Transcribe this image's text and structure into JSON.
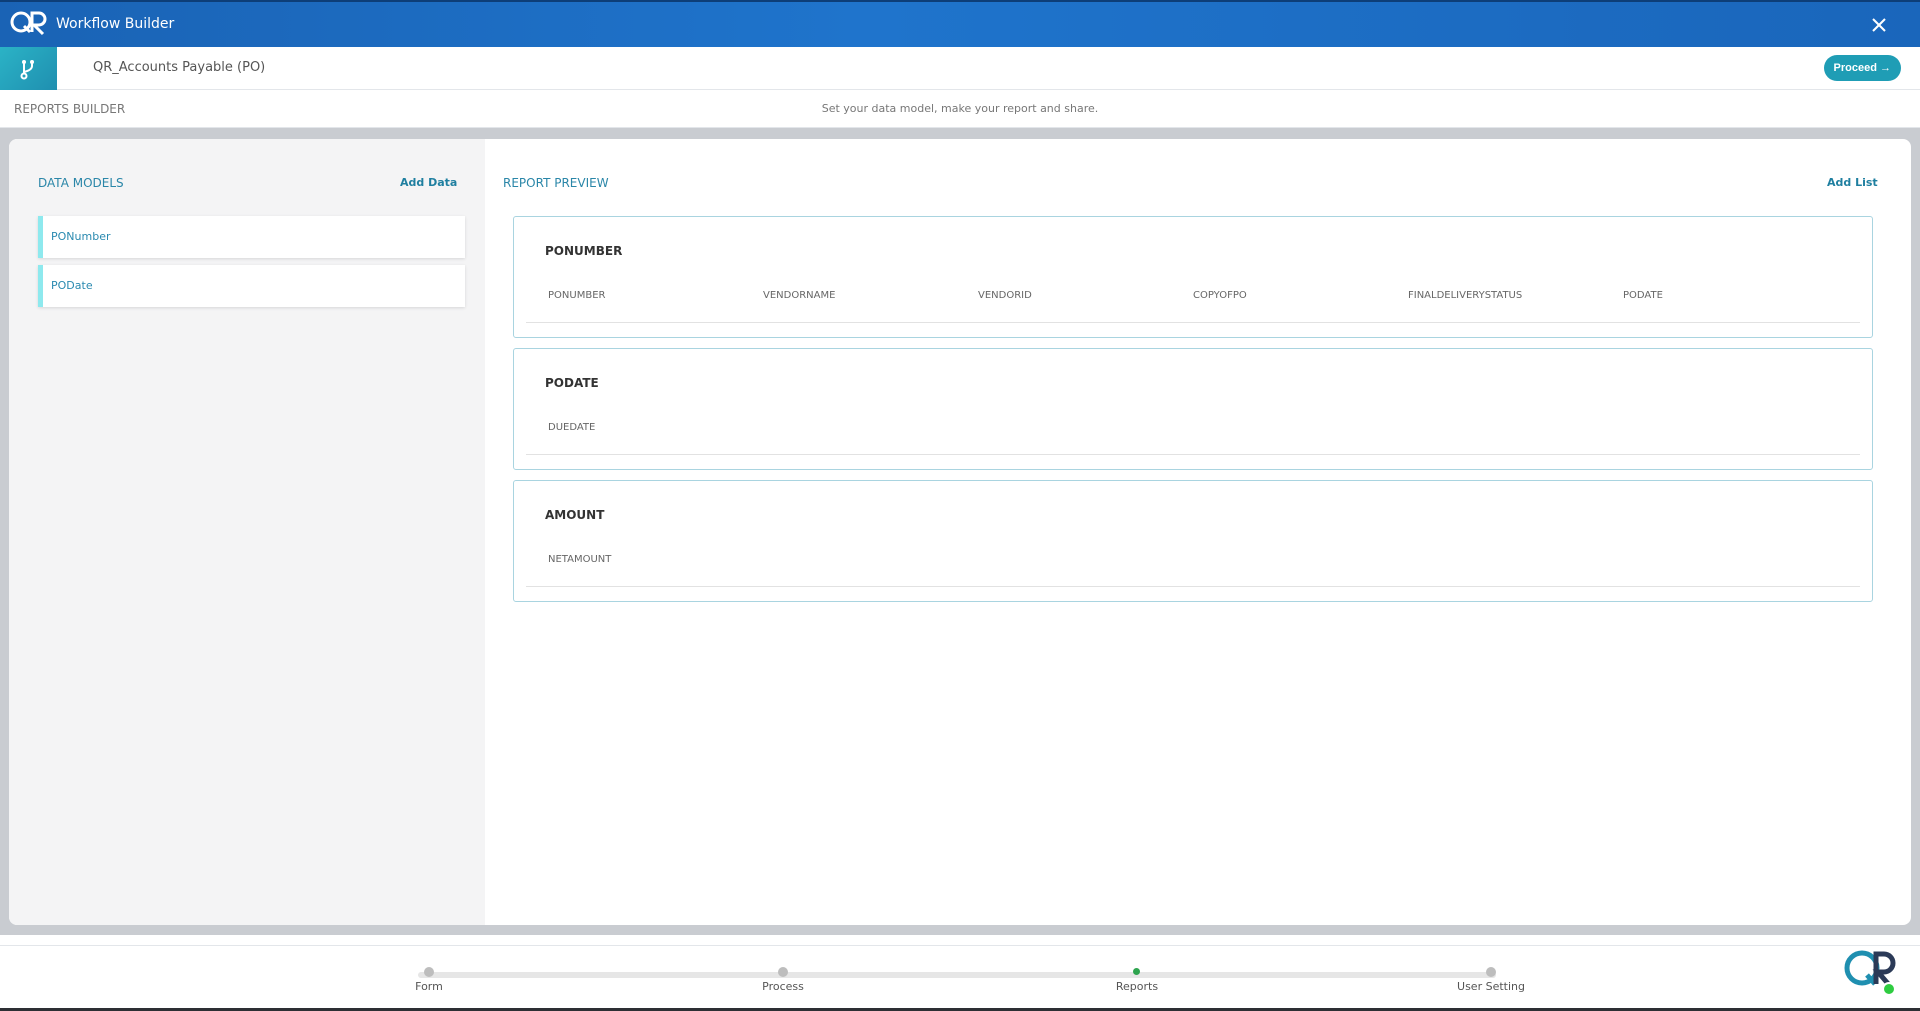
{
  "app": {
    "title": "Workflow Builder"
  },
  "workflow": {
    "name": "QR_Accounts Payable (PO)",
    "proceed_label": "Proceed →"
  },
  "builder": {
    "title": "REPORTS BUILDER",
    "subtitle": "Set your data model, make your report and share."
  },
  "data_models": {
    "title": "DATA MODELS",
    "add_label": "Add Data",
    "items": [
      "PONumber",
      "PODate"
    ]
  },
  "report_preview": {
    "title": "REPORT PREVIEW",
    "add_label": "Add List",
    "lists": [
      {
        "title": "PONUMBER",
        "columns": [
          "PONUMBER",
          "VENDORNAME",
          "VENDORID",
          "COPYOFPO",
          "FINALDELIVERYSTATUS",
          "PODATE"
        ]
      },
      {
        "title": "PODATE",
        "columns": [
          "DUEDATE"
        ]
      },
      {
        "title": "AMOUNT",
        "columns": [
          "NETAMOUNT"
        ]
      }
    ]
  },
  "stepper": {
    "steps": [
      "Form",
      "Process",
      "Reports",
      "User Setting"
    ],
    "active": "Reports",
    "active_color": "#2ea44f"
  },
  "colors": {
    "header": "#1f74cc",
    "accent": "#1f9db5",
    "model_border": "#8ee9ee"
  }
}
